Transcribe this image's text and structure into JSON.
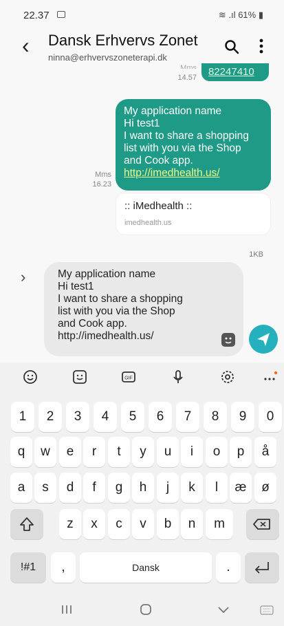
{
  "status_bar": {
    "time": "22.37",
    "battery": "61%"
  },
  "header": {
    "title": "Dansk Erhvervs Zonet",
    "subtitle": "ninna@erhvervszoneterapi.dk"
  },
  "prev_message": {
    "type": "Mms",
    "time": "14.57",
    "link": "82247410"
  },
  "message1": {
    "type": "Mms",
    "time": "16.23",
    "lines": [
      "My application name",
      "Hi test1",
      "I want to share a shopping",
      "list with you via the Shop",
      "and Cook app."
    ],
    "link": "http://imedhealth.us/",
    "preview_title": ":: iMedhealth ::",
    "preview_domain": "imedhealth.us",
    "size": "1KB"
  },
  "compose": {
    "lines": [
      "My application name",
      "Hi test1",
      "I want to share a shopping",
      "list with you via the Shop",
      "and Cook app.",
      "http://imedhealth.us/"
    ]
  },
  "keyboard": {
    "numbers": [
      "1",
      "2",
      "3",
      "4",
      "5",
      "6",
      "7",
      "8",
      "9",
      "0"
    ],
    "row1": [
      "q",
      "w",
      "e",
      "r",
      "t",
      "y",
      "u",
      "i",
      "o",
      "p",
      "å"
    ],
    "row2": [
      "a",
      "s",
      "d",
      "f",
      "g",
      "h",
      "j",
      "k",
      "l",
      "æ",
      "ø"
    ],
    "row3": [
      "z",
      "x",
      "c",
      "v",
      "b",
      "n",
      "m"
    ],
    "symbols_label": "!#1",
    "comma": ",",
    "space_label": "Dansk",
    "period": "."
  },
  "colors": {
    "accent": "#1f9a86",
    "send": "#24b0bd"
  }
}
